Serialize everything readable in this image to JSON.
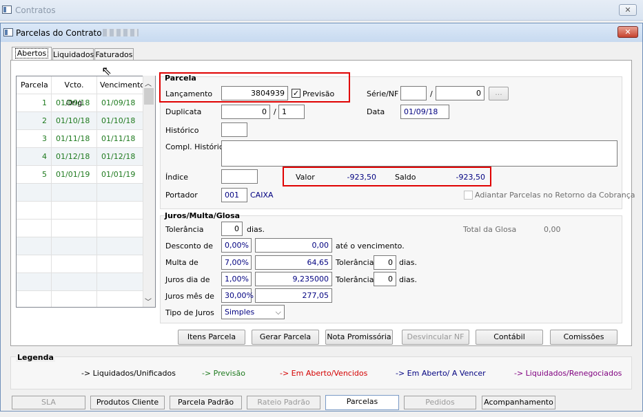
{
  "outer_window": {
    "title": "Contratos",
    "close_label": "✕"
  },
  "inner_window": {
    "title": "Parcelas do Contrato -",
    "close_label": "✕"
  },
  "tabs": [
    "Abertos",
    "Liquidados",
    "Faturados"
  ],
  "grid": {
    "headers": [
      "Parcela",
      "Vcto. Orig",
      "Vencimento"
    ],
    "rows": [
      {
        "parcela": "1",
        "vcto": "01/09/18",
        "venc": "01/09/18"
      },
      {
        "parcela": "2",
        "vcto": "01/10/18",
        "venc": "01/10/18"
      },
      {
        "parcela": "3",
        "vcto": "01/11/18",
        "venc": "01/11/18"
      },
      {
        "parcela": "4",
        "vcto": "01/12/18",
        "venc": "01/12/18"
      },
      {
        "parcela": "5",
        "vcto": "01/01/19",
        "venc": "01/01/19"
      }
    ]
  },
  "parcela": {
    "title": "Parcela",
    "lancamento_label": "Lançamento",
    "lancamento_value": "3804939",
    "previsao_label": "Previsão",
    "previsao_check": "✓",
    "serie_label": "Série/NF",
    "serie_value": "",
    "slash": "/",
    "nf_value": "0",
    "ellipsis": "...",
    "duplicata_label": "Duplicata",
    "duplicata_value": "0",
    "duplicata_of": "1",
    "data_label": "Data",
    "data_value": "01/09/18",
    "historico_label": "Histórico",
    "compl_label": "Compl. Histórico",
    "indice_label": "Índice",
    "valor_label": "Valor",
    "valor_value": "-923,50",
    "saldo_label": "Saldo",
    "saldo_value": "-923,50",
    "portador_label": "Portador",
    "portador_code": "001",
    "portador_name": "CAIXA",
    "adiantar_label": "Adiantar Parcelas no Retorno da Cobrança"
  },
  "juros": {
    "title": "Juros/Multa/Glosa",
    "tolerancia_label": "Tolerância",
    "tolerancia_value": "0",
    "dias": "dias.",
    "total_glosa_label": "Total da Glosa",
    "total_glosa_value": "0,00",
    "desconto_label": "Desconto de",
    "desconto_pct": "0,00%",
    "desconto_value": "0,00",
    "ate_label": "até o vencimento.",
    "multa_label": "Multa de",
    "multa_pct": "7,00%",
    "multa_value": "64,65",
    "multa_tol_label": "Tolerância",
    "multa_tol_value": "0",
    "juros_dia_label": "Juros dia de",
    "juros_dia_pct": "1,00%",
    "juros_dia_value": "9,235000",
    "juros_tol_label": "Tolerância",
    "juros_tol_value": "0",
    "juros_mes_label": "Juros mês de",
    "juros_mes_pct": "30,00%",
    "juros_mes_value": "277,05",
    "tipo_label": "Tipo de Juros",
    "tipo_value": "Simples"
  },
  "actions": [
    "Itens Parcela",
    "Gerar Parcela",
    "Nota Promissória",
    "Desvincular NF",
    "Contábil",
    "Comissões"
  ],
  "legend": {
    "title": "Legenda",
    "items": [
      {
        "text": "-> Liquidados/Unificados",
        "color": "#000000"
      },
      {
        "text": "-> Previsão",
        "color": "#1e7a1e"
      },
      {
        "text": "-> Em Aberto/Vencidos",
        "color": "#d40000"
      },
      {
        "text": "-> Em Aberto/ A Vencer",
        "color": "#000080"
      },
      {
        "text": "-> Liquidados/Renegociados",
        "color": "#800080"
      }
    ]
  },
  "bottom_tabs": [
    "SLA",
    "Produtos Cliente",
    "Parcela Padrão",
    "Rateio Padrão",
    "Parcelas",
    "Pedidos",
    "Acompanhamento"
  ]
}
